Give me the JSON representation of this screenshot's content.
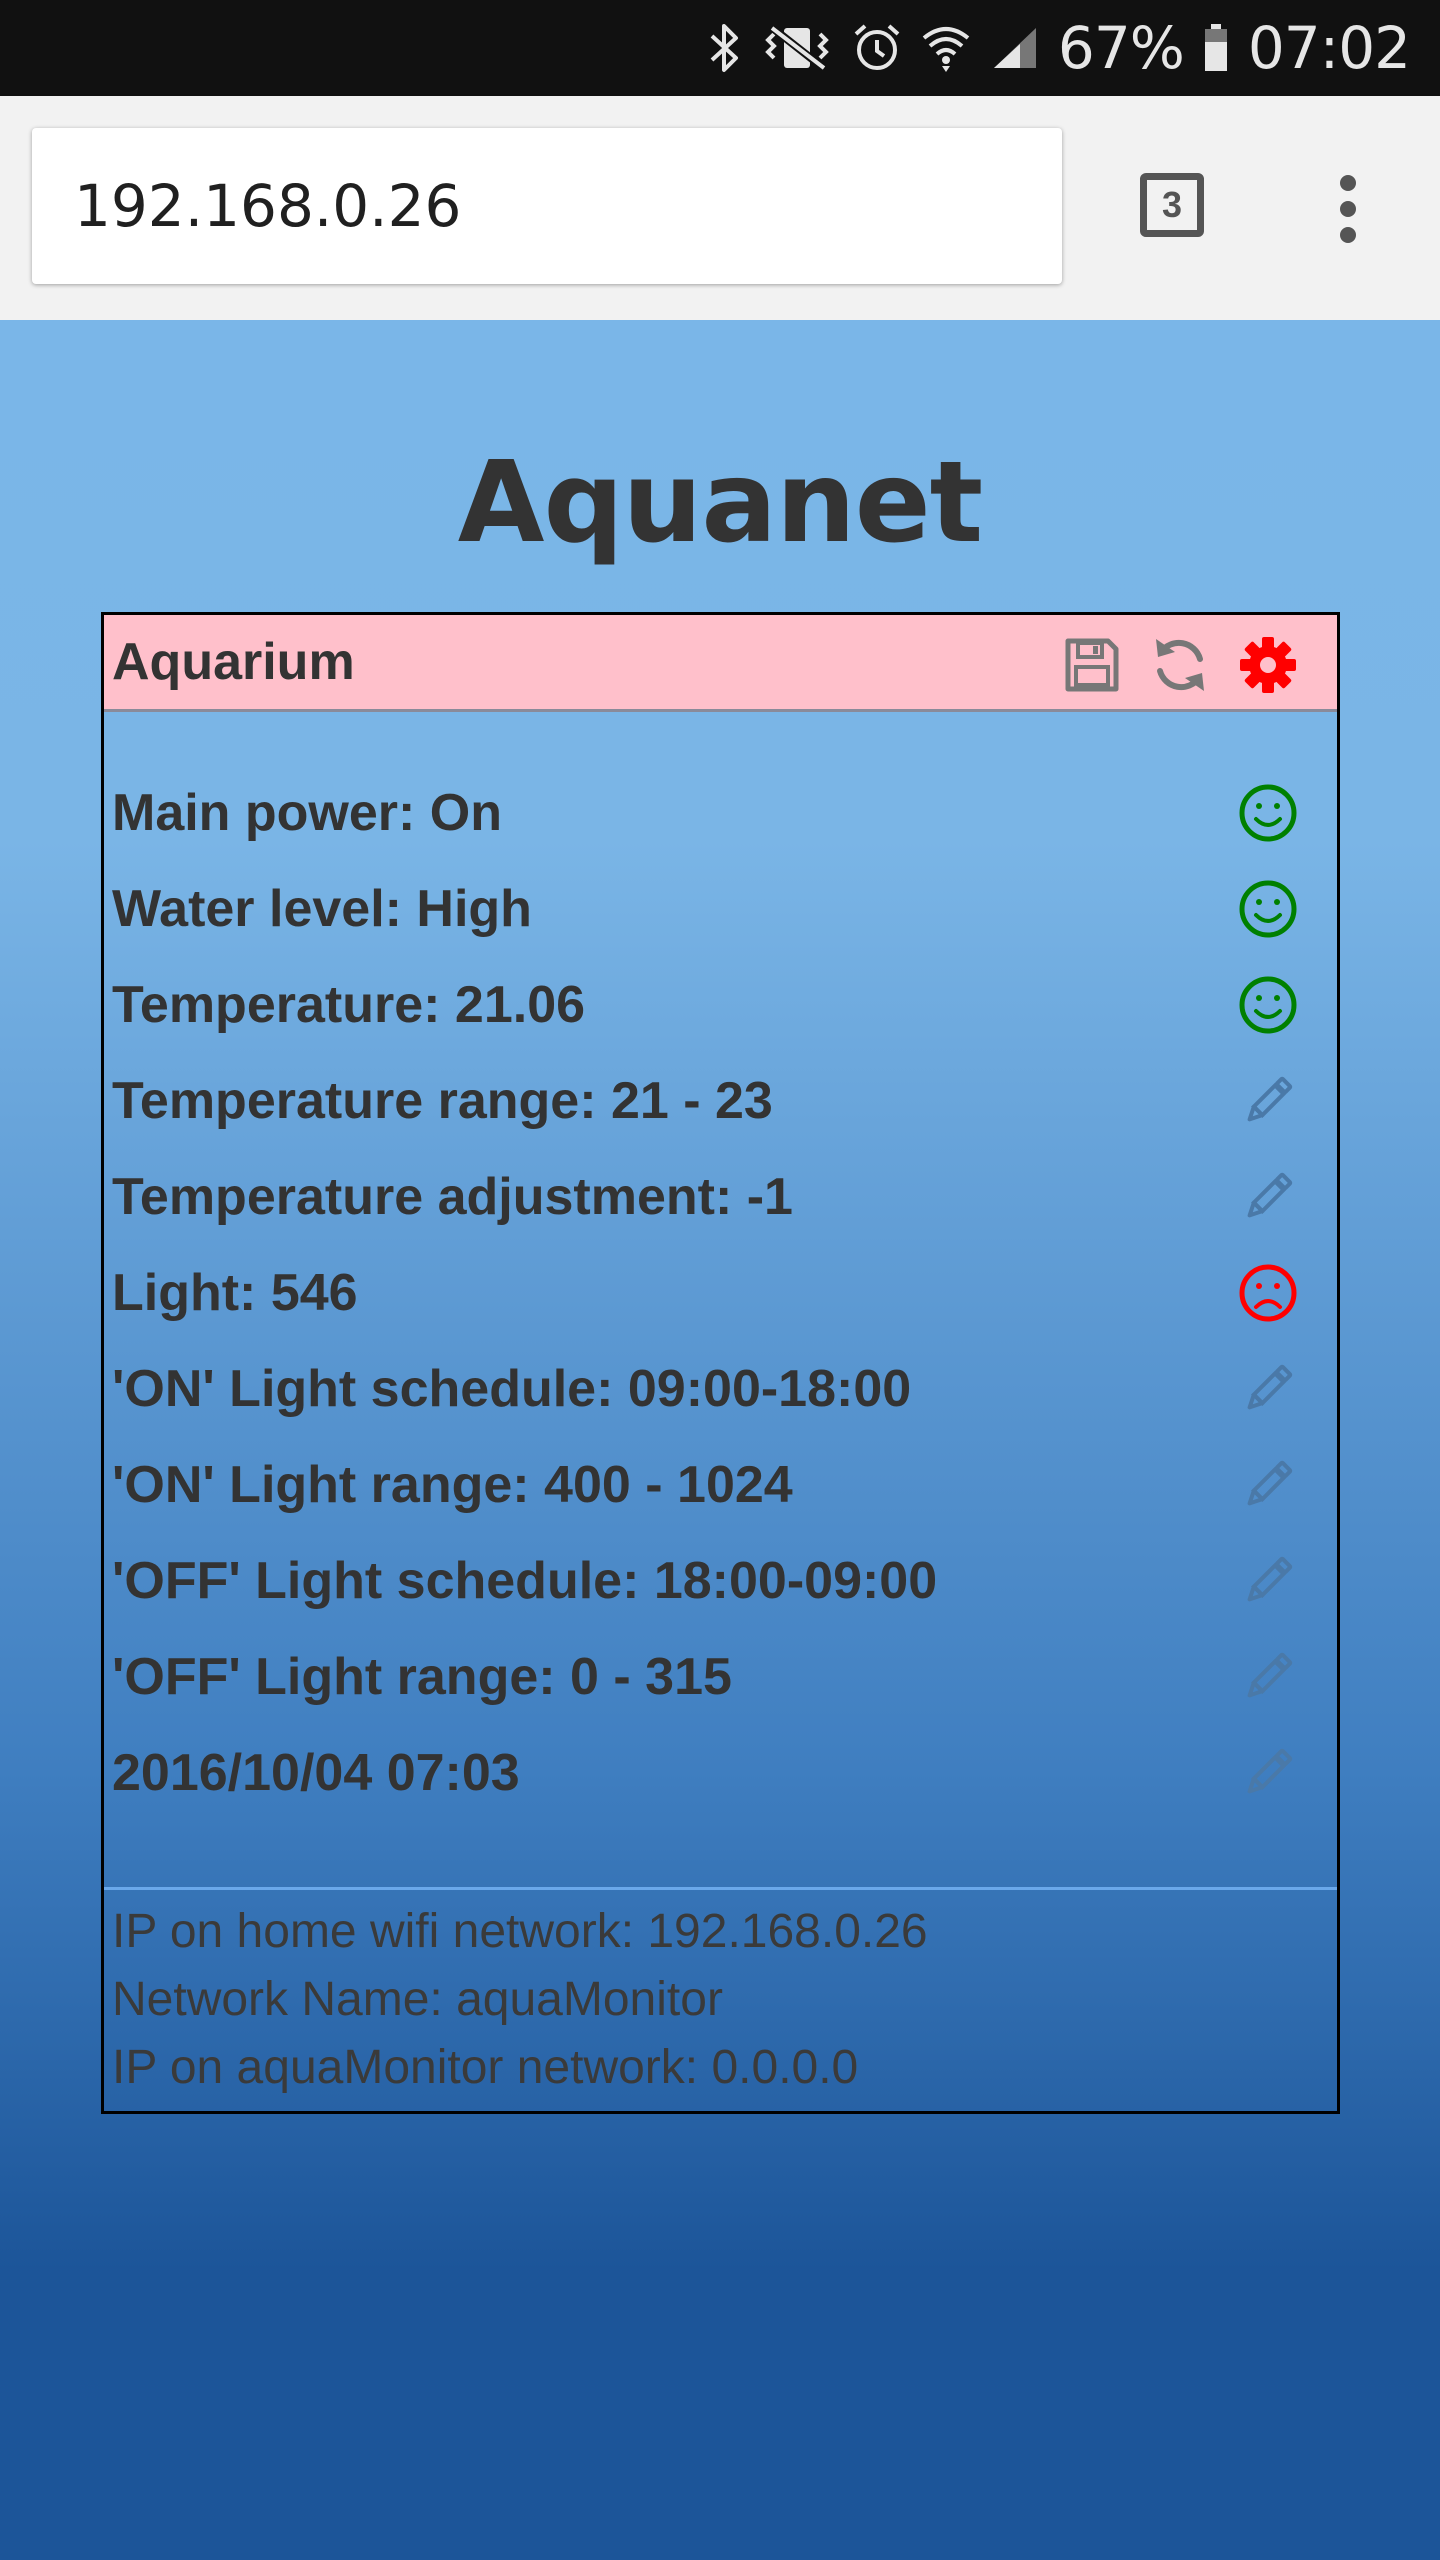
{
  "status_bar": {
    "icons": [
      "bluetooth-icon",
      "vibrate-icon",
      "alarm-icon",
      "wifi-icon",
      "signal-icon"
    ],
    "battery_percent": "67%",
    "time": "07:02"
  },
  "browser": {
    "url": "192.168.0.26",
    "tab_count": "3"
  },
  "page": {
    "title": "Aquanet",
    "panel": {
      "title": "Aquarium",
      "colors": {
        "header_bg": "#ffc0cb",
        "ok": "#008000",
        "alert": "#ff0000",
        "edit": "#4a79a8",
        "disabled": "#777777"
      },
      "rows": [
        {
          "label": "Main power: On",
          "icon": "happy-face-icon"
        },
        {
          "label": "Water level: High",
          "icon": "happy-face-icon"
        },
        {
          "label": "Temperature: 21.06",
          "icon": "happy-face-icon"
        },
        {
          "label": "Temperature range: 21 - 23",
          "icon": "pencil-icon"
        },
        {
          "label": "Temperature adjustment: -1",
          "icon": "pencil-icon"
        },
        {
          "label": "Light: 546",
          "icon": "sad-face-icon"
        },
        {
          "label": "'ON' Light schedule: 09:00-18:00",
          "icon": "pencil-icon"
        },
        {
          "label": "'ON' Light range: 400 - 1024",
          "icon": "pencil-icon"
        },
        {
          "label": "'OFF' Light schedule: 18:00-09:00",
          "icon": "pencil-icon"
        },
        {
          "label": "'OFF' Light range: 0 - 315",
          "icon": "pencil-icon"
        },
        {
          "label": "2016/10/04 07:03",
          "icon": "pencil-icon"
        }
      ],
      "footer": [
        "IP on home wifi network: 192.168.0.26",
        "Network Name: aquaMonitor",
        "IP on aquaMonitor network: 0.0.0.0"
      ]
    }
  }
}
